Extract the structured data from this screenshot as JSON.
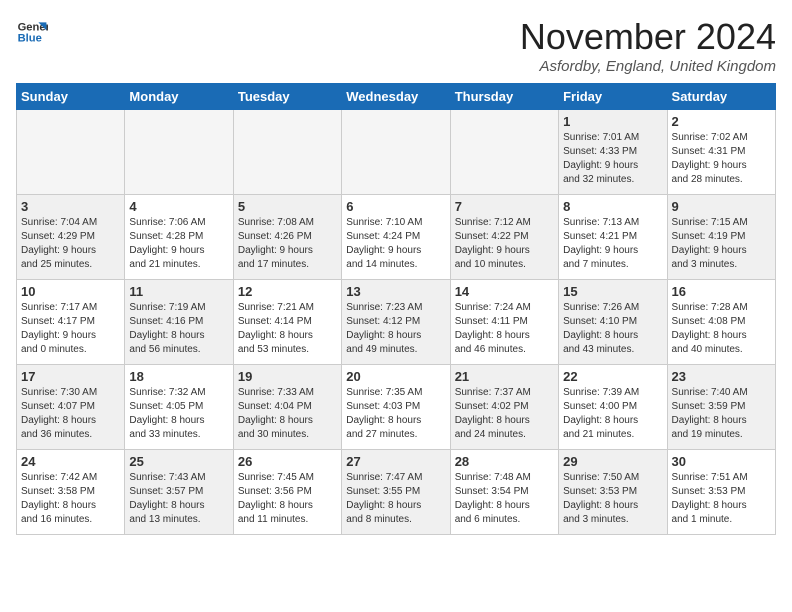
{
  "logo": {
    "line1": "General",
    "line2": "Blue"
  },
  "title": "November 2024",
  "location": "Asfordby, England, United Kingdom",
  "weekdays": [
    "Sunday",
    "Monday",
    "Tuesday",
    "Wednesday",
    "Thursday",
    "Friday",
    "Saturday"
  ],
  "weeks": [
    [
      {
        "day": "",
        "info": "",
        "empty": true
      },
      {
        "day": "",
        "info": "",
        "empty": true
      },
      {
        "day": "",
        "info": "",
        "empty": true
      },
      {
        "day": "",
        "info": "",
        "empty": true
      },
      {
        "day": "",
        "info": "",
        "empty": true
      },
      {
        "day": "1",
        "info": "Sunrise: 7:01 AM\nSunset: 4:33 PM\nDaylight: 9 hours\nand 32 minutes.",
        "empty": false,
        "shaded": true
      },
      {
        "day": "2",
        "info": "Sunrise: 7:02 AM\nSunset: 4:31 PM\nDaylight: 9 hours\nand 28 minutes.",
        "empty": false,
        "shaded": false
      }
    ],
    [
      {
        "day": "3",
        "info": "Sunrise: 7:04 AM\nSunset: 4:29 PM\nDaylight: 9 hours\nand 25 minutes.",
        "empty": false,
        "shaded": true
      },
      {
        "day": "4",
        "info": "Sunrise: 7:06 AM\nSunset: 4:28 PM\nDaylight: 9 hours\nand 21 minutes.",
        "empty": false,
        "shaded": false
      },
      {
        "day": "5",
        "info": "Sunrise: 7:08 AM\nSunset: 4:26 PM\nDaylight: 9 hours\nand 17 minutes.",
        "empty": false,
        "shaded": true
      },
      {
        "day": "6",
        "info": "Sunrise: 7:10 AM\nSunset: 4:24 PM\nDaylight: 9 hours\nand 14 minutes.",
        "empty": false,
        "shaded": false
      },
      {
        "day": "7",
        "info": "Sunrise: 7:12 AM\nSunset: 4:22 PM\nDaylight: 9 hours\nand 10 minutes.",
        "empty": false,
        "shaded": true
      },
      {
        "day": "8",
        "info": "Sunrise: 7:13 AM\nSunset: 4:21 PM\nDaylight: 9 hours\nand 7 minutes.",
        "empty": false,
        "shaded": false
      },
      {
        "day": "9",
        "info": "Sunrise: 7:15 AM\nSunset: 4:19 PM\nDaylight: 9 hours\nand 3 minutes.",
        "empty": false,
        "shaded": true
      }
    ],
    [
      {
        "day": "10",
        "info": "Sunrise: 7:17 AM\nSunset: 4:17 PM\nDaylight: 9 hours\nand 0 minutes.",
        "empty": false,
        "shaded": false
      },
      {
        "day": "11",
        "info": "Sunrise: 7:19 AM\nSunset: 4:16 PM\nDaylight: 8 hours\nand 56 minutes.",
        "empty": false,
        "shaded": true
      },
      {
        "day": "12",
        "info": "Sunrise: 7:21 AM\nSunset: 4:14 PM\nDaylight: 8 hours\nand 53 minutes.",
        "empty": false,
        "shaded": false
      },
      {
        "day": "13",
        "info": "Sunrise: 7:23 AM\nSunset: 4:12 PM\nDaylight: 8 hours\nand 49 minutes.",
        "empty": false,
        "shaded": true
      },
      {
        "day": "14",
        "info": "Sunrise: 7:24 AM\nSunset: 4:11 PM\nDaylight: 8 hours\nand 46 minutes.",
        "empty": false,
        "shaded": false
      },
      {
        "day": "15",
        "info": "Sunrise: 7:26 AM\nSunset: 4:10 PM\nDaylight: 8 hours\nand 43 minutes.",
        "empty": false,
        "shaded": true
      },
      {
        "day": "16",
        "info": "Sunrise: 7:28 AM\nSunset: 4:08 PM\nDaylight: 8 hours\nand 40 minutes.",
        "empty": false,
        "shaded": false
      }
    ],
    [
      {
        "day": "17",
        "info": "Sunrise: 7:30 AM\nSunset: 4:07 PM\nDaylight: 8 hours\nand 36 minutes.",
        "empty": false,
        "shaded": true
      },
      {
        "day": "18",
        "info": "Sunrise: 7:32 AM\nSunset: 4:05 PM\nDaylight: 8 hours\nand 33 minutes.",
        "empty": false,
        "shaded": false
      },
      {
        "day": "19",
        "info": "Sunrise: 7:33 AM\nSunset: 4:04 PM\nDaylight: 8 hours\nand 30 minutes.",
        "empty": false,
        "shaded": true
      },
      {
        "day": "20",
        "info": "Sunrise: 7:35 AM\nSunset: 4:03 PM\nDaylight: 8 hours\nand 27 minutes.",
        "empty": false,
        "shaded": false
      },
      {
        "day": "21",
        "info": "Sunrise: 7:37 AM\nSunset: 4:02 PM\nDaylight: 8 hours\nand 24 minutes.",
        "empty": false,
        "shaded": true
      },
      {
        "day": "22",
        "info": "Sunrise: 7:39 AM\nSunset: 4:00 PM\nDaylight: 8 hours\nand 21 minutes.",
        "empty": false,
        "shaded": false
      },
      {
        "day": "23",
        "info": "Sunrise: 7:40 AM\nSunset: 3:59 PM\nDaylight: 8 hours\nand 19 minutes.",
        "empty": false,
        "shaded": true
      }
    ],
    [
      {
        "day": "24",
        "info": "Sunrise: 7:42 AM\nSunset: 3:58 PM\nDaylight: 8 hours\nand 16 minutes.",
        "empty": false,
        "shaded": false
      },
      {
        "day": "25",
        "info": "Sunrise: 7:43 AM\nSunset: 3:57 PM\nDaylight: 8 hours\nand 13 minutes.",
        "empty": false,
        "shaded": true
      },
      {
        "day": "26",
        "info": "Sunrise: 7:45 AM\nSunset: 3:56 PM\nDaylight: 8 hours\nand 11 minutes.",
        "empty": false,
        "shaded": false
      },
      {
        "day": "27",
        "info": "Sunrise: 7:47 AM\nSunset: 3:55 PM\nDaylight: 8 hours\nand 8 minutes.",
        "empty": false,
        "shaded": true
      },
      {
        "day": "28",
        "info": "Sunrise: 7:48 AM\nSunset: 3:54 PM\nDaylight: 8 hours\nand 6 minutes.",
        "empty": false,
        "shaded": false
      },
      {
        "day": "29",
        "info": "Sunrise: 7:50 AM\nSunset: 3:53 PM\nDaylight: 8 hours\nand 3 minutes.",
        "empty": false,
        "shaded": true
      },
      {
        "day": "30",
        "info": "Sunrise: 7:51 AM\nSunset: 3:53 PM\nDaylight: 8 hours\nand 1 minute.",
        "empty": false,
        "shaded": false
      }
    ]
  ]
}
